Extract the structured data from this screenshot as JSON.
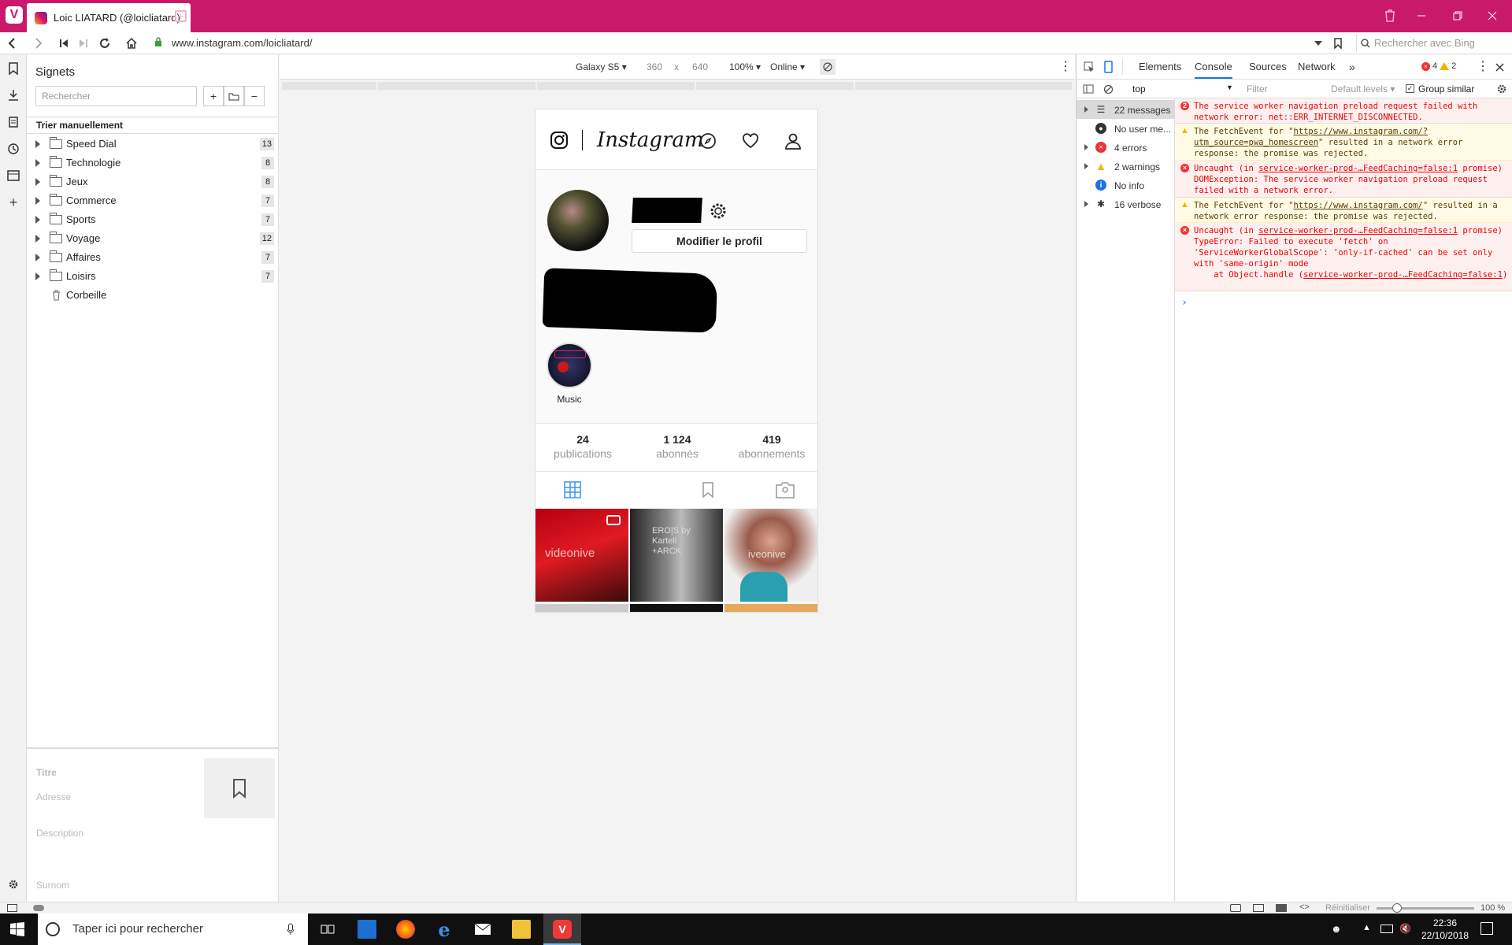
{
  "browser": {
    "tab_title": "Loic LIATARD (@loicliatard)",
    "url": "www.instagram.com/loicliatard/",
    "search_placeholder": "Rechercher avec Bing"
  },
  "bookmarks": {
    "title": "Signets",
    "search_placeholder": "Rechercher",
    "sort_label": "Trier manuellement",
    "items": [
      {
        "label": "Speed Dial",
        "count": "13"
      },
      {
        "label": "Technologie",
        "count": "8"
      },
      {
        "label": "Jeux",
        "count": "8"
      },
      {
        "label": "Commerce",
        "count": "7"
      },
      {
        "label": "Sports",
        "count": "7"
      },
      {
        "label": "Voyage",
        "count": "12"
      },
      {
        "label": "Affaires",
        "count": "7"
      },
      {
        "label": "Loisirs",
        "count": "7"
      }
    ],
    "trash": "Corbeille",
    "fields": {
      "title": "Titre",
      "address": "Adresse",
      "description": "Description",
      "nickname": "Surnom"
    }
  },
  "device_toolbar": {
    "device": "Galaxy S5 ▾",
    "width": "360",
    "times": "x",
    "height": "640",
    "zoom": "100% ▾",
    "network": "Online ▾"
  },
  "instagram": {
    "logo_text": "Instagram",
    "edit_profile": "Modifier le profil",
    "highlight": "Music",
    "stats": [
      {
        "value": "24",
        "label": "publications"
      },
      {
        "value": "1 124",
        "label": "abonnés"
      },
      {
        "value": "419",
        "label": "abonnements"
      }
    ],
    "thumb_texts": [
      "videonive",
      "ERO|S by Kartell +ARCK",
      "iveonive"
    ]
  },
  "devtools": {
    "tabs": [
      "Elements",
      "Console",
      "Sources",
      "Network"
    ],
    "active_tab": "Console",
    "error_count": "4",
    "warning_count": "2",
    "context": "top",
    "filter_placeholder": "Filter",
    "levels": "Default levels ▾",
    "group_similar": "Group similar",
    "sidebar": [
      {
        "label": "22 messages"
      },
      {
        "label": "No user me..."
      },
      {
        "label": "4 errors"
      },
      {
        "label": "2 warnings"
      },
      {
        "label": "No info"
      },
      {
        "label": "16 verbose"
      }
    ],
    "messages": [
      {
        "type": "error",
        "text": "The service worker navigation preload request failed with network error: net::ERR_INTERNET_DISCONNECTED.",
        "badge": "2"
      },
      {
        "type": "warning",
        "pre": "The FetchEvent for \"",
        "link": "https://www.instagram.com/?utm_source=pwa_homescreen",
        "post": "\" resulted in a network error response: the promise was rejected."
      },
      {
        "type": "error",
        "pre": "Uncaught (in       ",
        "link": "service-worker-prod-…FeedCaching=false:1",
        "post": " promise) DOMException: The service worker navigation preload request failed with a network error."
      },
      {
        "type": "warning",
        "pre": "The FetchEvent for \"",
        "link": "https://www.instagram.com/",
        "post": "\" resulted in a network error response: the promise was rejected."
      },
      {
        "type": "error",
        "pre": "Uncaught (in       ",
        "link": "service-worker-prod-…FeedCaching=false:1",
        "post": " promise) TypeError: Failed to execute 'fetch' on 'ServiceWorkerGlobalScope': 'only-if-cached' can be set only with 'same-origin' mode",
        "tail_pre": "    at Object.handle (",
        "tail_link": "service-worker-prod-…FeedCaching=false:1",
        "tail_post": ")"
      }
    ]
  },
  "statusbar": {
    "reset": "Réinitialiser",
    "zoom": "100 %"
  },
  "taskbar": {
    "search_placeholder": "Taper ici pour rechercher",
    "time": "22:36",
    "date": "22/10/2018"
  }
}
